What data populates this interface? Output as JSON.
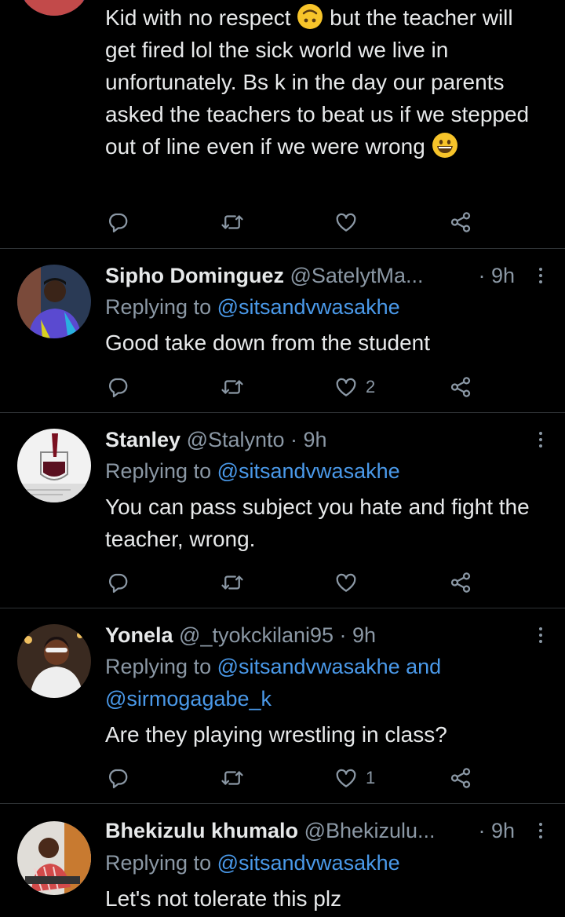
{
  "tweets": [
    {
      "body": {
        "part1": "Kid with no respect",
        "part2": "but the teacher will get fired lol the sick world we live in unfortunately. Bs k in the day our parents asked the teachers to beat us if we stepped out of line even if we were wrong"
      },
      "emoji1": "upside-down-face-emoji",
      "emoji2": "grinning-face-emoji",
      "likes": ""
    },
    {
      "name": "Sipho Dominguez",
      "handle": "@SatelytMa...",
      "time": "· 9h",
      "replying_prefix": "Replying to ",
      "mentions": "@sitsandvwasakhe",
      "body": "Good take down from the student",
      "likes": "2"
    },
    {
      "name": "Stanley",
      "handle": "@Stalynto · 9h",
      "replying_prefix": "Replying to ",
      "mentions": "@sitsandvwasakhe",
      "body": "You can pass subject you hate and fight the teacher, wrong.",
      "likes": ""
    },
    {
      "name": "Yonela",
      "handle": "@_tyokckilani95 · 9h",
      "replying_prefix": "Replying to ",
      "mentions": "@sitsandvwasakhe and @sirmogagabe_k",
      "body": "Are they playing wrestling in class?",
      "likes": "1"
    },
    {
      "name": "Bhekizulu khumalo",
      "handle": "@Bhekizulu...",
      "time": "· 9h",
      "replying_prefix": "Replying to ",
      "mentions": "@sitsandvwasakhe",
      "body": "Let's not tolerate this plz"
    }
  ],
  "icons": {
    "reply": "reply-icon",
    "retweet": "retweet-icon",
    "like": "like-icon",
    "share": "share-icon",
    "more": "more-icon"
  },
  "colors": {
    "background": "#000000",
    "text": "#e7e9ea",
    "muted": "#8b98a5",
    "mention": "#4a99e9",
    "divider": "#2f3336"
  }
}
